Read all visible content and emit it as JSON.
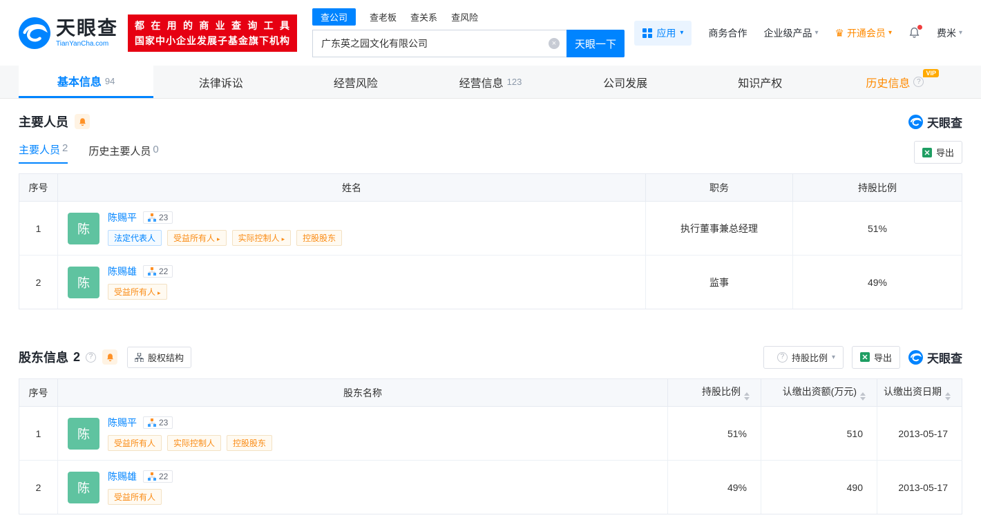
{
  "icons": {
    "question": "?",
    "caret": "▾",
    "crown": "♛",
    "clear": "×"
  },
  "header": {
    "logo": {
      "name": "天眼查",
      "domain": "TianYanCha.com"
    },
    "slogan": {
      "line1": "都在用的商业查询工具",
      "line2": "国家中小企业发展子基金旗下机构"
    },
    "search": {
      "tabs": [
        {
          "label": "查公司"
        },
        {
          "label": "查老板"
        },
        {
          "label": "查关系"
        },
        {
          "label": "查风险"
        }
      ],
      "value": "广东英之园文化有限公司",
      "button": "天眼一下"
    },
    "right": {
      "apps": "应用",
      "cooperation": "商务合作",
      "enterprise": "企业级产品",
      "vip": "开通会员",
      "user": "费米"
    }
  },
  "nav": {
    "vip_badge": "VIP",
    "tabs": [
      {
        "label": "基本信息",
        "count": "94"
      },
      {
        "label": "法律诉讼",
        "count": ""
      },
      {
        "label": "经营风险",
        "count": ""
      },
      {
        "label": "经营信息",
        "count": "123"
      },
      {
        "label": "公司发展",
        "count": ""
      },
      {
        "label": "知识产权",
        "count": ""
      },
      {
        "label": "历史信息",
        "count": ""
      }
    ]
  },
  "staff": {
    "title": "主要人员",
    "brand": "天眼查",
    "export": "导出",
    "tabs": [
      {
        "label": "主要人员",
        "count": "2"
      },
      {
        "label": "历史主要人员",
        "count": "0"
      }
    ],
    "headers": [
      "序号",
      "姓名",
      "职务",
      "持股比例"
    ],
    "rows": [
      {
        "no": "1",
        "avatar": "陈",
        "name": "陈赐平",
        "badge": "23",
        "tags": [
          "法定代表人",
          "受益所有人",
          "实际控制人",
          "控股股东"
        ],
        "position": "执行董事兼总经理",
        "ratio": "51%"
      },
      {
        "no": "2",
        "avatar": "陈",
        "name": "陈赐雄",
        "badge": "22",
        "tags": [
          "受益所有人"
        ],
        "position": "监事",
        "ratio": "49%"
      }
    ]
  },
  "shareholders": {
    "title": "股东信息",
    "count": "2",
    "structure": "股权结构",
    "filter": "持股比例",
    "export": "导出",
    "brand": "天眼查",
    "headers": [
      "序号",
      "股东名称",
      "持股比例",
      "认缴出资额(万元)",
      "认缴出资日期"
    ],
    "rows": [
      {
        "no": "1",
        "avatar": "陈",
        "name": "陈赐平",
        "badge": "23",
        "tags": [
          "受益所有人",
          "实际控制人",
          "控股股东"
        ],
        "ratio": "51%",
        "amount": "510",
        "date": "2013-05-17"
      },
      {
        "no": "2",
        "avatar": "陈",
        "name": "陈赐雄",
        "badge": "22",
        "tags": [
          "受益所有人"
        ],
        "ratio": "49%",
        "amount": "490",
        "date": "2013-05-17"
      }
    ]
  }
}
